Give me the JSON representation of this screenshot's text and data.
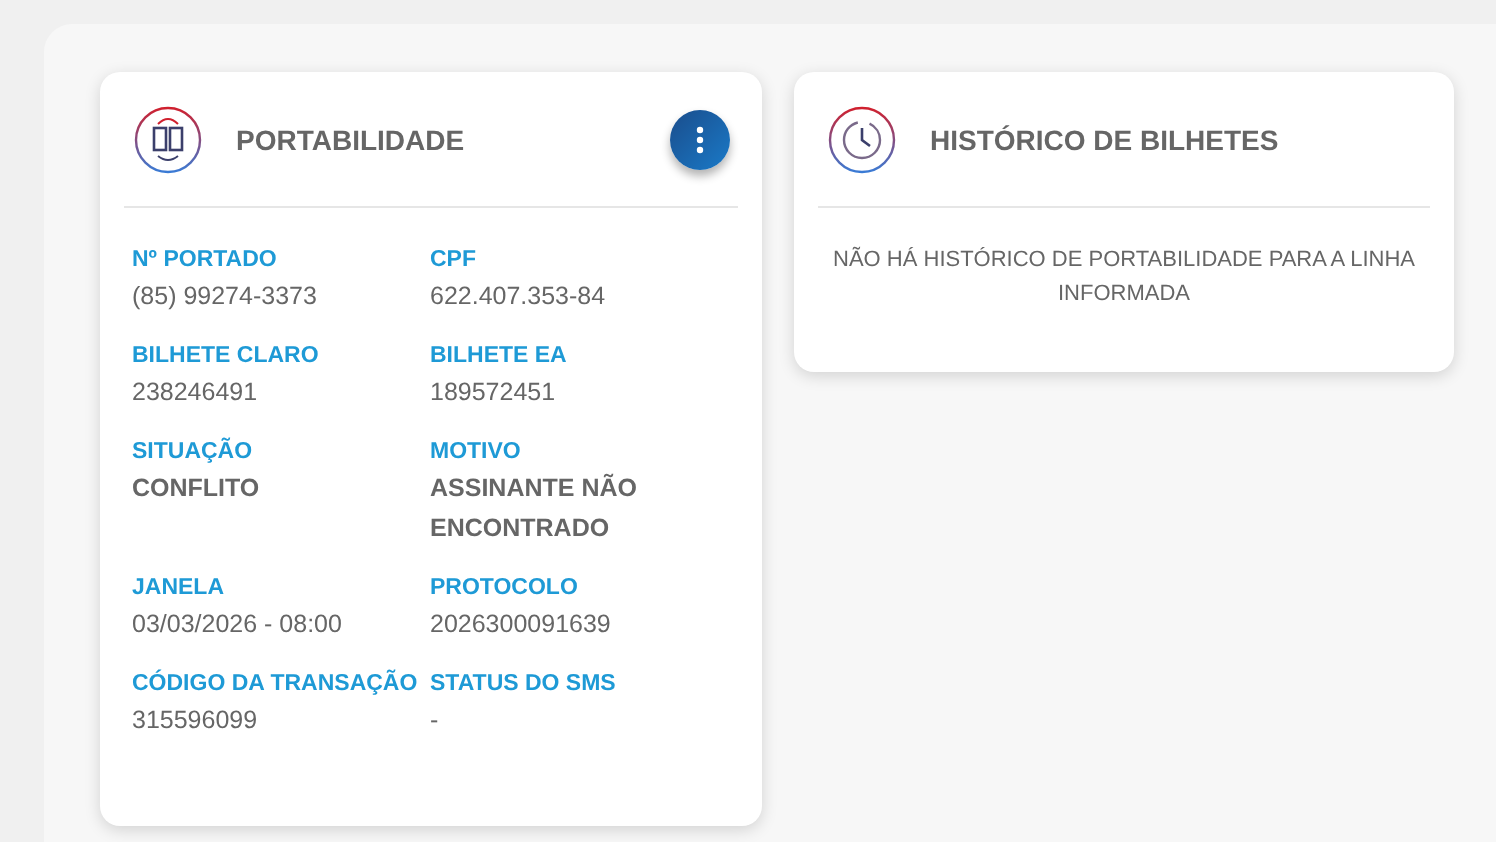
{
  "portability_card": {
    "title": "PORTABILIDADE",
    "fields": [
      {
        "label": "Nº PORTADO",
        "value": "(85) 99274-3373",
        "emphasis": false
      },
      {
        "label": "CPF",
        "value": "622.407.353-84",
        "emphasis": false
      },
      {
        "label": "BILHETE CLARO",
        "value": "238246491",
        "emphasis": false
      },
      {
        "label": "BILHETE EA",
        "value": "189572451",
        "emphasis": false
      },
      {
        "label": "SITUAÇÃO",
        "value": "CONFLITO",
        "emphasis": true
      },
      {
        "label": "MOTIVO",
        "value": "ASSINANTE NÃO ENCONTRADO",
        "emphasis": true
      },
      {
        "label": "JANELA",
        "value": "03/03/2026 - 08:00",
        "emphasis": false
      },
      {
        "label": "PROTOCOLO",
        "value": "2026300091639",
        "emphasis": false
      },
      {
        "label": "CÓDIGO DA TRANSAÇÃO",
        "value": "315596099",
        "emphasis": false
      },
      {
        "label": "STATUS DO SMS",
        "value": "-",
        "emphasis": false
      }
    ]
  },
  "history_card": {
    "title": "HISTÓRICO DE BILHETES",
    "message": "NÃO HÁ HISTÓRICO DE PORTABILIDADE PARA A LINHA INFORMADA"
  }
}
